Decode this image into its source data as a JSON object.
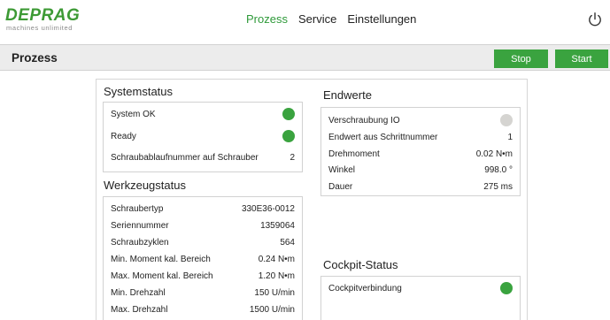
{
  "brand": {
    "name": "DEPRAG",
    "tagline": "machines unlimited"
  },
  "nav": {
    "items": [
      {
        "label": "Prozess",
        "active": true
      },
      {
        "label": "Service",
        "active": false
      },
      {
        "label": "Einstellungen",
        "active": false
      }
    ]
  },
  "header": {
    "power_icon": "power-icon"
  },
  "page": {
    "title": "Prozess"
  },
  "toolbar": {
    "stop_label": "Stop",
    "start_label": "Start"
  },
  "colors": {
    "accent": "#3aa33f",
    "indicator_off": "#d5d4d1"
  },
  "systemstatus": {
    "title": "Systemstatus",
    "rows": [
      {
        "label": "System OK",
        "indicator": "green"
      },
      {
        "label": "Ready",
        "indicator": "green"
      },
      {
        "label": "Schraubablaufnummer auf Schrauber",
        "value": "2"
      }
    ]
  },
  "werkzeugstatus": {
    "title": "Werkzeugstatus",
    "rows": [
      {
        "label": "Schraubertyp",
        "value": "330E36-0012"
      },
      {
        "label": "Seriennummer",
        "value": "1359064"
      },
      {
        "label": "Schraubzyklen",
        "value": "564"
      },
      {
        "label": "Min. Moment kal. Bereich",
        "value": "0.24 N•m"
      },
      {
        "label": "Max. Moment kal. Bereich",
        "value": "1.20 N•m"
      },
      {
        "label": "Min. Drehzahl",
        "value": "150 U/min"
      },
      {
        "label": "Max. Drehzahl",
        "value": "1500 U/min"
      }
    ]
  },
  "endwerte": {
    "title": "Endwerte",
    "rows": [
      {
        "label": "Verschraubung IO",
        "indicator": "grey"
      },
      {
        "label": "Endwert aus Schrittnummer",
        "value": "1"
      },
      {
        "label": "Drehmoment",
        "value": "0.02 N•m"
      },
      {
        "label": "Winkel",
        "value": "998.0 °"
      },
      {
        "label": "Dauer",
        "value": "275 ms"
      }
    ]
  },
  "cockpit": {
    "title": "Cockpit-Status",
    "rows": [
      {
        "label": "Cockpitverbindung",
        "indicator": "green"
      }
    ]
  }
}
